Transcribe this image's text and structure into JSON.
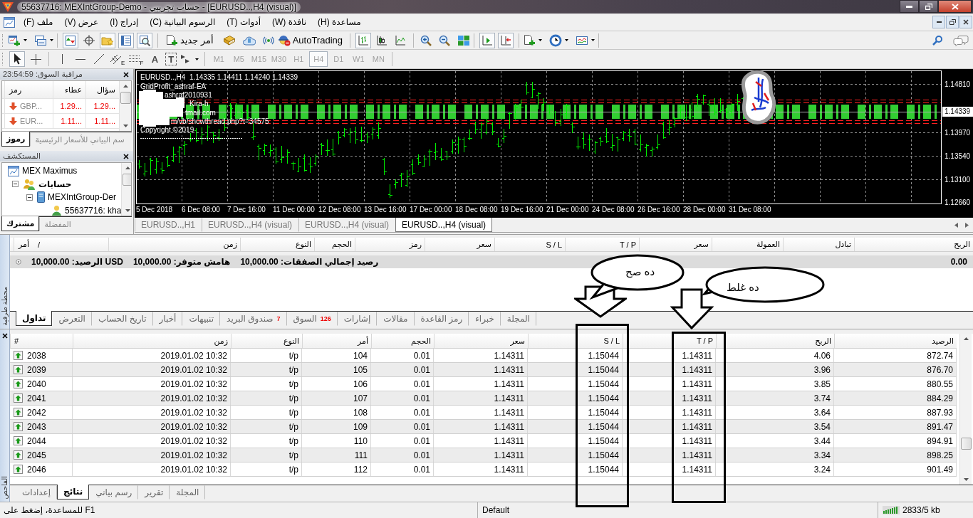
{
  "window": {
    "title": "55637716: MEXIntGroup-Demo - حساب تجريبي - [EURUSD..,H4 (visual)]"
  },
  "menu": [
    "(H) مساعدة",
    "(W) نافذة",
    "(T) أدوات",
    "(C) الرسوم البيانية",
    "(I) إدراج",
    "(V) عرض",
    "(F) ملف"
  ],
  "toolbar": {
    "view_buttons": [
      {
        "kind": "tester",
        "pressed": true
      },
      {
        "kind": "terminal",
        "pressed": true
      },
      {
        "kind": "navigator",
        "pressed": true
      },
      {
        "kind": "data-window",
        "pressed": false
      },
      {
        "kind": "market-watch",
        "pressed": true
      }
    ],
    "autotrading": "AutoTrading",
    "new_order": "أمر جديد",
    "chart_types": [
      {
        "kind": "line",
        "pressed": false
      },
      {
        "kind": "candles",
        "pressed": false
      },
      {
        "kind": "bars",
        "pressed": true
      }
    ],
    "scroll_buttons": [
      {
        "kind": "chart-shift",
        "pressed": true
      },
      {
        "kind": "auto-scroll",
        "pressed": true
      }
    ]
  },
  "drawing_toolbar": {
    "timeframes": [
      {
        "label": "MN",
        "selected": false,
        "disabled": true
      },
      {
        "label": "W1",
        "selected": false,
        "disabled": true
      },
      {
        "label": "D1",
        "selected": false,
        "disabled": true
      },
      {
        "label": "H4",
        "selected": true,
        "disabled": true
      },
      {
        "label": "H1",
        "selected": false,
        "disabled": true
      },
      {
        "label": "M30",
        "selected": false,
        "disabled": true
      },
      {
        "label": "M15",
        "selected": false,
        "disabled": true
      },
      {
        "label": "M5",
        "selected": false,
        "disabled": true
      },
      {
        "label": "M1",
        "selected": false,
        "disabled": true
      }
    ],
    "tools": [
      {
        "kind": "arrows",
        "pressed": false
      },
      {
        "kind": "label",
        "glyph": "T",
        "pressed": false
      },
      {
        "kind": "text",
        "glyph": "A",
        "pressed": false
      },
      {
        "kind": "fibo",
        "mark": "F",
        "pressed": false
      },
      {
        "kind": "channel",
        "mark": "E",
        "pressed": false
      },
      {
        "kind": "trendline",
        "pressed": false
      },
      {
        "kind": "hline",
        "pressed": false
      },
      {
        "kind": "vline",
        "pressed": false
      },
      {
        "kind": "crosshair",
        "pressed": false
      },
      {
        "kind": "cursor",
        "pressed": true
      }
    ]
  },
  "market_watch": {
    "title": "مراقبة السوق: 23:54:59",
    "columns": [
      "سؤال",
      "عطاء",
      "رمز"
    ],
    "rows": [
      {
        "symbol": "GBP...",
        "bid": "1.29...",
        "ask": "1.29...",
        "up": false
      },
      {
        "symbol": "EUR...",
        "bid": "1.11...",
        "ask": "1.11...",
        "up": false
      }
    ],
    "tabs": [
      {
        "label": "سم البياني للأسعار الرئيسية",
        "selected": false
      },
      {
        "label": "رموز",
        "selected": true
      }
    ]
  },
  "navigator": {
    "title": "المستكشف",
    "tree": [
      {
        "label": "MEX Maximus",
        "kind": "terminal",
        "children": [
          {
            "label": "حسابات",
            "kind": "accounts",
            "expanded": true,
            "children": [
              {
                "label": "MEXIntGroup-Der",
                "kind": "server",
                "expanded": true,
                "children": [
                  {
                    "label": "55637716: kha",
                    "kind": "account"
                  }
                ]
              }
            ]
          }
        ]
      }
    ],
    "tabs": [
      {
        "label": "المفضلة",
        "selected": false
      },
      {
        "label": "مشترك",
        "selected": true
      }
    ]
  },
  "chart": {
    "info_lines": [
      "EURUSD..,H4  1.14335 1.14411 1.14240 1.14339",
      "GridProfit_ashraf-EA",
      "ashraf2010931",
      "Kira-h",
      "tmail.com",
      "m/vb/showthread.php?t=34575",
      "Copyright ©2019"
    ],
    "price_labels": [
      "1.14810",
      "1.13970",
      "1.13540",
      "1.13100",
      "1.12660"
    ],
    "current_price": "1.14339",
    "time_labels": [
      "31 Dec 08:00",
      "28 Dec 00:00",
      "26 Dec 16:00",
      "24 Dec 08:00",
      "21 Dec 00:00",
      "19 Dec 16:00",
      "18 Dec 08:00",
      "17 Dec 00:00",
      "13 Dec 16:00",
      "12 Dec 08:00",
      "11 Dec 00:00",
      "7 Dec 16:00",
      "6 Dec 08:00",
      "5 Dec 2018"
    ],
    "tabs": [
      {
        "label": "EURUSD..,H4 (visual)",
        "selected": true
      },
      {
        "label": "EURUSD..,H4 (visual)",
        "selected": false
      },
      {
        "label": "EURUSD..,H4 (visual)",
        "selected": false
      },
      {
        "label": "EURUSD..,H1",
        "selected": false
      }
    ]
  },
  "terminal": {
    "title": "محطة طرفية",
    "columns": [
      "الربح",
      "تبادل",
      "العمولة",
      "سعر",
      "T / P",
      "S / L",
      "سعر",
      "رمز",
      "الحجم",
      "النوع",
      "زمن",
      "أمر"
    ],
    "sort_mark": "/",
    "profit": "0.00",
    "summary": [
      "رصيد إجمالي الصفقات: 10,000.00",
      "هامش متوفر: 10,000.00",
      "USD الرصيد: 10,000.00"
    ],
    "tabs": [
      {
        "label": "المجلة",
        "selected": false
      },
      {
        "label": "خبراء",
        "selected": false
      },
      {
        "label": "رمز القاعدة",
        "selected": false
      },
      {
        "label": "مقالات",
        "selected": false
      },
      {
        "label": "إشارات",
        "selected": false
      },
      {
        "label": "السوق",
        "count": "126",
        "selected": false
      },
      {
        "label": "صندوق البريد",
        "count": "7",
        "selected": false
      },
      {
        "label": "تنبيهات",
        "selected": false
      },
      {
        "label": "أخبار",
        "selected": false
      },
      {
        "label": "تاريخ الحساب",
        "selected": false
      },
      {
        "label": "التعرض",
        "selected": false
      },
      {
        "label": "تداول",
        "selected": true
      }
    ]
  },
  "tester": {
    "title": "الفاحص",
    "columns": [
      "الرصيد",
      "الربح",
      "T / P",
      "S / L",
      "سعر",
      "الحجم",
      "أمر",
      "النوع",
      "زمن",
      "#"
    ],
    "rows": [
      {
        "number": "2038",
        "time": "2019.01.02 10:32",
        "type": "t/p",
        "order": "104",
        "size": "0.01",
        "price": "1.14311",
        "sl": "1.15044",
        "tp": "1.14311",
        "profit": "4.06",
        "balance": "872.74",
        "up": true
      },
      {
        "number": "2039",
        "time": "2019.01.02 10:32",
        "type": "t/p",
        "order": "105",
        "size": "0.01",
        "price": "1.14311",
        "sl": "1.15044",
        "tp": "1.14311",
        "profit": "3.96",
        "balance": "876.70",
        "up": true
      },
      {
        "number": "2040",
        "time": "2019.01.02 10:32",
        "type": "t/p",
        "order": "106",
        "size": "0.01",
        "price": "1.14311",
        "sl": "1.15044",
        "tp": "1.14311",
        "profit": "3.85",
        "balance": "880.55",
        "up": true
      },
      {
        "number": "2041",
        "time": "2019.01.02 10:32",
        "type": "t/p",
        "order": "107",
        "size": "0.01",
        "price": "1.14311",
        "sl": "1.15044",
        "tp": "1.14311",
        "profit": "3.74",
        "balance": "884.29",
        "up": true
      },
      {
        "number": "2042",
        "time": "2019.01.02 10:32",
        "type": "t/p",
        "order": "108",
        "size": "0.01",
        "price": "1.14311",
        "sl": "1.15044",
        "tp": "1.14311",
        "profit": "3.64",
        "balance": "887.93",
        "up": true
      },
      {
        "number": "2043",
        "time": "2019.01.02 10:32",
        "type": "t/p",
        "order": "109",
        "size": "0.01",
        "price": "1.14311",
        "sl": "1.15044",
        "tp": "1.14311",
        "profit": "3.54",
        "balance": "891.47",
        "up": true
      },
      {
        "number": "2044",
        "time": "2019.01.02 10:32",
        "type": "t/p",
        "order": "110",
        "size": "0.01",
        "price": "1.14311",
        "sl": "1.15044",
        "tp": "1.14311",
        "profit": "3.44",
        "balance": "894.91",
        "up": true
      },
      {
        "number": "2045",
        "time": "2019.01.02 10:32",
        "type": "t/p",
        "order": "111",
        "size": "0.01",
        "price": "1.14311",
        "sl": "1.15044",
        "tp": "1.14311",
        "profit": "3.34",
        "balance": "898.25",
        "up": true
      },
      {
        "number": "2046",
        "time": "2019.01.02 10:32",
        "type": "t/p",
        "order": "112",
        "size": "0.01",
        "price": "1.14311",
        "sl": "1.15044",
        "tp": "1.14311",
        "profit": "3.24",
        "balance": "901.49",
        "up": true
      }
    ],
    "tabs": [
      {
        "label": "المجلة",
        "selected": false
      },
      {
        "label": "تقرير",
        "selected": false
      },
      {
        "label": "رسم بياني",
        "selected": false
      },
      {
        "label": "نتائج",
        "selected": true
      },
      {
        "label": "إعدادات",
        "selected": false
      }
    ]
  },
  "status_bar": {
    "help": "للمساعدة، إضغط على F1",
    "profile": "Default",
    "traffic": "2833/5 kb"
  },
  "annotations": [
    {
      "text": "ده غلط"
    },
    {
      "text": "ده صح"
    }
  ]
}
